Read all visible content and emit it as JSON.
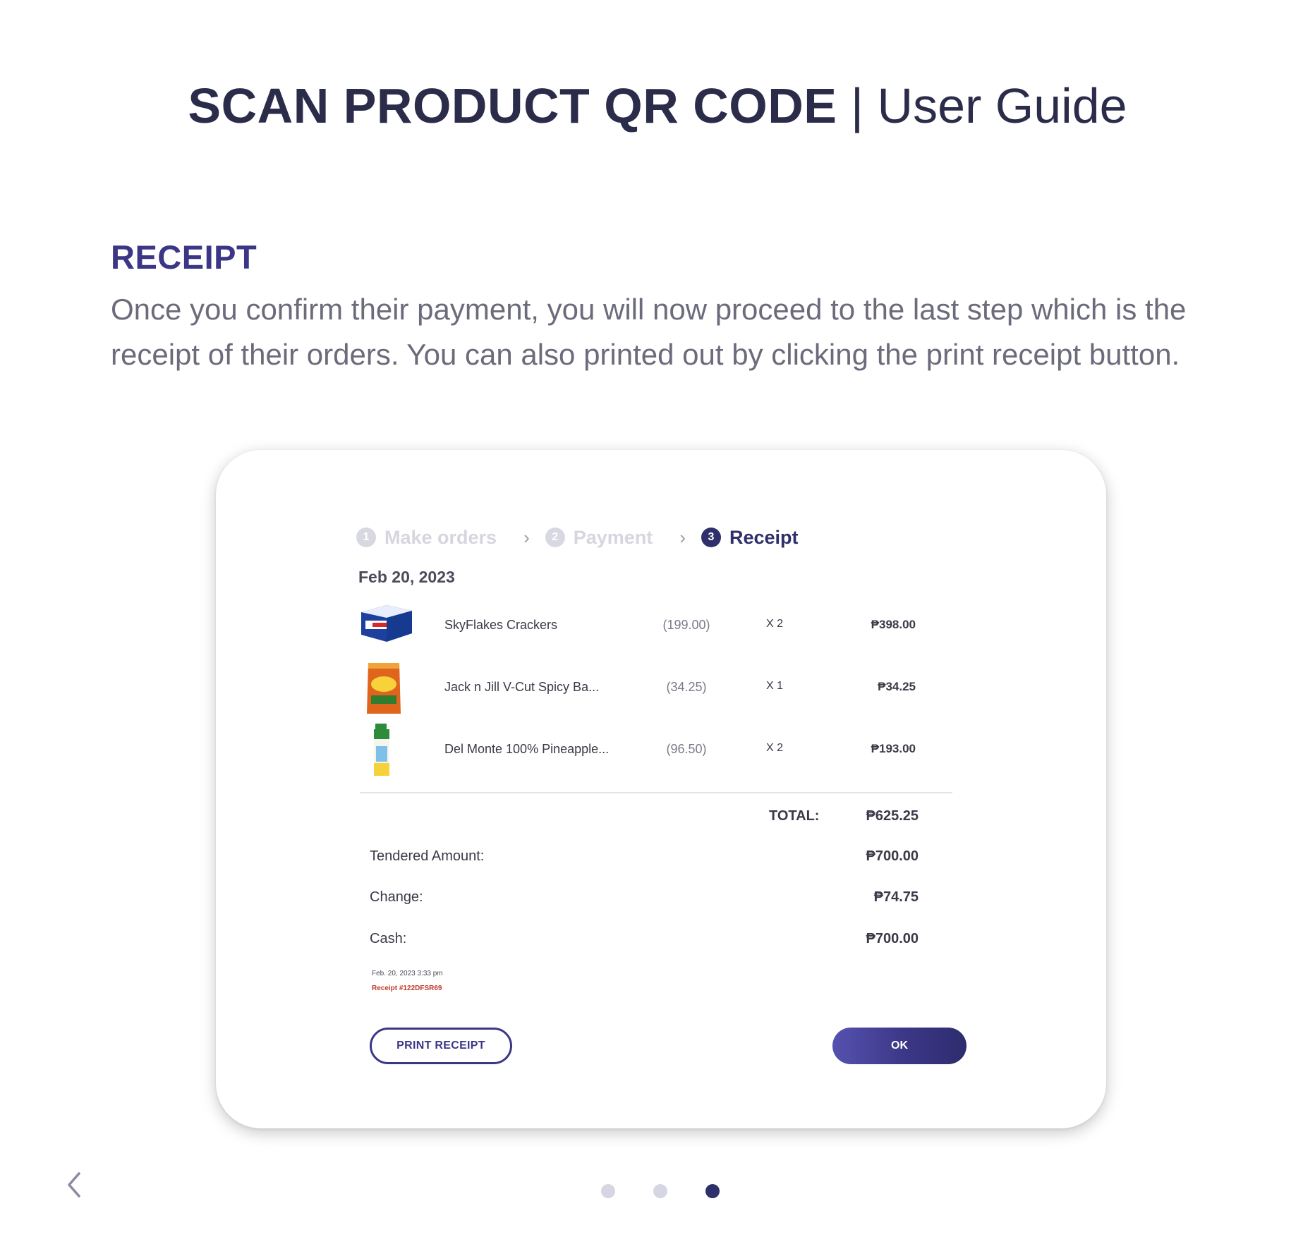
{
  "header": {
    "title_bold": "SCAN PRODUCT QR CODE",
    "separator": " | ",
    "title_light": "User Guide"
  },
  "section": {
    "heading": "RECEIPT",
    "body": "Once you confirm their payment, you will now proceed to the last step which is the receipt of their orders. You can also printed out by clicking the print receipt button."
  },
  "stepper": {
    "steps": [
      {
        "num": "1",
        "label": "Make orders",
        "active": false
      },
      {
        "num": "2",
        "label": "Payment",
        "active": false
      },
      {
        "num": "3",
        "label": "Receipt",
        "active": true
      }
    ]
  },
  "receipt": {
    "date": "Feb 20, 2023",
    "items": [
      {
        "name": "SkyFlakes Crackers",
        "unit_price": "(199.00)",
        "qty": "X 2",
        "amount": "₱398.00",
        "icon": "crackers-box-icon"
      },
      {
        "name": "Jack n Jill V-Cut Spicy Ba...",
        "unit_price": "(34.25)",
        "qty": "X 1",
        "amount": "₱34.25",
        "icon": "chips-bag-icon"
      },
      {
        "name": "Del Monte 100% Pineapple...",
        "unit_price": "(96.50)",
        "qty": "X 2",
        "amount": "₱193.00",
        "icon": "juice-carton-icon"
      }
    ],
    "total_label": "TOTAL:",
    "total_value": "₱625.25",
    "tendered_label": "Tendered Amount:",
    "tendered_value": "₱700.00",
    "change_label": "Change:",
    "change_value": "₱74.75",
    "cash_label": "Cash:",
    "cash_value": "₱700.00",
    "timestamp": "Feb. 20, 2023 3:33 pm",
    "receipt_number": "Receipt #122DFSR69"
  },
  "actions": {
    "print_label": "PRINT RECEIPT",
    "ok_label": "OK"
  },
  "pagination": {
    "total": 3,
    "current": 3
  },
  "colors": {
    "title": "#2b2c4a",
    "accent": "#3b3786",
    "body_text": "#6b6b7b",
    "receipt_number": "#c0392b"
  }
}
